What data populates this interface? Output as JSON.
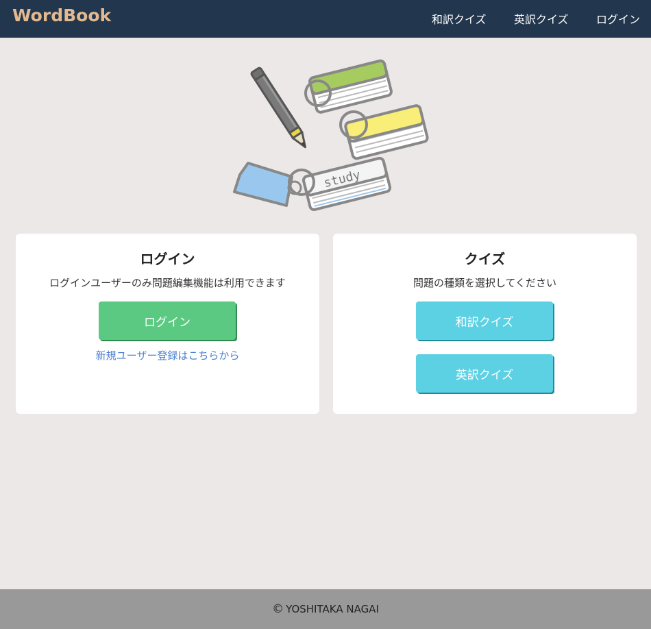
{
  "header": {
    "brand": "WordBook",
    "nav": [
      {
        "label": "和訳クイズ"
      },
      {
        "label": "英訳クイズ"
      },
      {
        "label": "ログイン"
      }
    ]
  },
  "hero": {
    "icon": "study-flashcards-pencil-illustration",
    "card_text": "study"
  },
  "login_card": {
    "title": "ログイン",
    "description": "ログインユーザーのみ問題編集機能は利用できます",
    "button_label": "ログイン",
    "register_link": "新規ユーザー登録はこちらから"
  },
  "quiz_card": {
    "title": "クイズ",
    "description": "問題の種類を選択してください",
    "buttons": [
      {
        "label": "和訳クイズ"
      },
      {
        "label": "英訳クイズ"
      }
    ]
  },
  "footer": {
    "copyright_symbol": "©",
    "text": "YOSHITAKA NAGAI"
  },
  "colors": {
    "navbar": "#22364e",
    "brand": "#e5b98e",
    "background": "#ede8e8",
    "login_button": "#5cc982",
    "quiz_button": "#5dd1e4",
    "link": "#4a7fcf",
    "footer": "#999999"
  }
}
